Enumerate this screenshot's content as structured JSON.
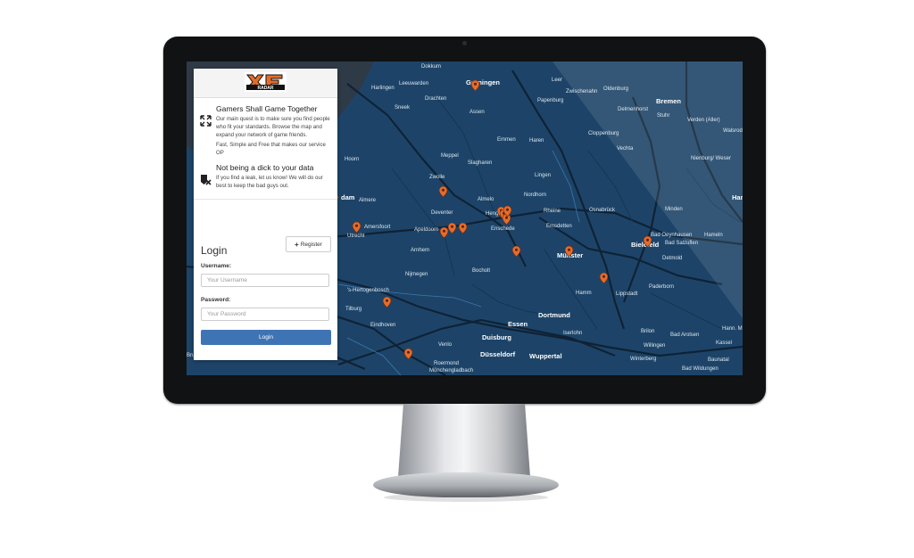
{
  "page": {
    "brand_logo_text": "XF RADAR",
    "features": [
      {
        "title": "Gamers Shall Game Together",
        "body": "Our main quest is to make sure you find people who fit your standards. Browse the map and expand your network of game friends.",
        "body2": "Fast, Simple and Free that makes our service OP",
        "icon": "expand-arrows-icon"
      },
      {
        "title": "Not being a dick to your data",
        "body": "If you find a leak, let us know! We will do our best to keep the bad guys out.",
        "icon": "shield-x-icon"
      }
    ],
    "login": {
      "title": "Login",
      "register_label": "Register",
      "username_label": "Username:",
      "username_placeholder": "Your Username",
      "password_label": "Password:",
      "password_placeholder": "Your Password",
      "submit_label": "Login"
    }
  },
  "map": {
    "labels": [
      "Groningen",
      "Leeuwarden",
      "Harlingen",
      "Dokkum",
      "Drachten",
      "Sneek",
      "Assen",
      "Emmen",
      "Haren",
      "Meppel",
      "Papenburg",
      "Leer",
      "Zwischenahn",
      "Oldenburg",
      "Bremen",
      "Delmenhorst",
      "Stuhr",
      "Verden (Aller)",
      "Walsrod",
      "Cloppenburg",
      "Vechta",
      "Nienburg/ Weser",
      "Lingen",
      "Nordhorn",
      "Zwolle",
      "Almelo",
      "Hengelo",
      "Enschede",
      "Hoorn",
      "Almere",
      "Amersfoort",
      "Utrecht",
      "Deventer",
      "Apeldoorn",
      "Arnhem",
      "Nijmegen",
      "Bocholt",
      "Rheine",
      "Osnabrück",
      "Emsdetten",
      "Münster",
      "Minden",
      "Bad Oeynhausen",
      "Bielefeld",
      "Bad Salzuflen",
      "Hameln",
      "Detmold",
      "Paderborn",
      "Hamm",
      "Lippstadt",
      "'s-Hertogenbosch",
      "Tilburg",
      "Eindhoven",
      "Dortmund",
      "Essen",
      "Duisburg",
      "Düsseldorf",
      "Wuppertal",
      "Iserlohn",
      "Brilon",
      "Bad Arolsen",
      "Kassel",
      "Willingen",
      "Winterberg",
      "Baunatal",
      "Bad Wildungen",
      "Venlo",
      "Roermond",
      "Mönchengladbach",
      "Hann. M",
      "Brugg",
      "dam",
      "Han",
      "Slagharen"
    ],
    "pins_count": 17
  },
  "colors": {
    "map_water": "#1d4468",
    "road": "#0e1f30",
    "pin": "#e56c2c",
    "accent_button": "#3f74b4"
  }
}
